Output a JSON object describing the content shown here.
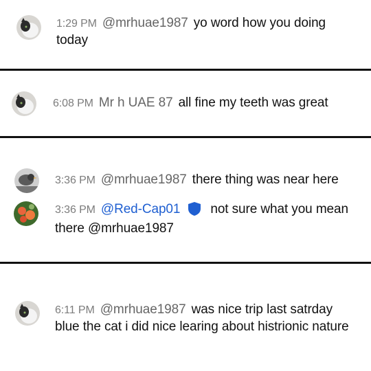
{
  "messages": [
    {
      "time": "1:29 PM",
      "author": "@mrhuae1987",
      "text": "yo word how you doing today",
      "avatar": "cat-avatar-icon"
    },
    {
      "time": "6:08 PM",
      "author": "Mr h UAE 87",
      "text": "all fine my teeth was great",
      "avatar": "cat-avatar-icon"
    },
    {
      "time": "3:36 PM",
      "author": "@mrhuae1987",
      "text": "there thing was near here",
      "avatar": "bird-avatar-icon"
    },
    {
      "time": "3:36 PM",
      "author": "@Red-Cap01",
      "text": "not sure what you mean there @mrhuae1987",
      "avatar": "flower-avatar-icon",
      "badge": "moderator-shield-icon"
    },
    {
      "time": "6:11 PM",
      "author": "@mrhuae1987",
      "text": "was nice trip last satrday blue the cat i did nice learing about histrionic nature",
      "avatar": "cat-avatar-icon"
    }
  ],
  "colors": {
    "timestamp": "#7c7c7c",
    "author": "#666666",
    "moderator_author": "#1f5fd1",
    "divider": "#111111"
  }
}
